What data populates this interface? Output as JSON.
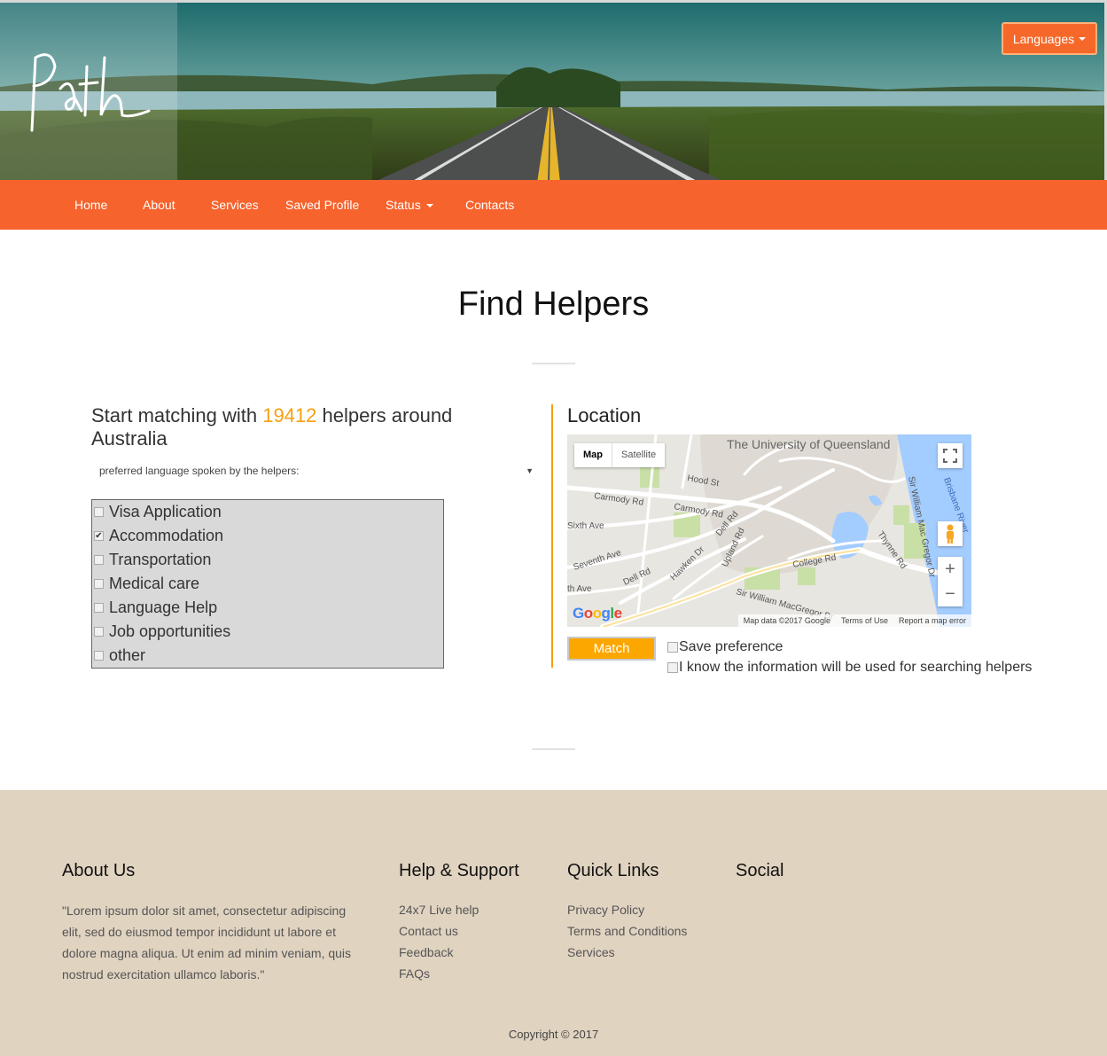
{
  "header": {
    "logo_text": "Path",
    "languages_label": "Languages"
  },
  "nav": {
    "items": [
      {
        "label": "Home"
      },
      {
        "label": "About"
      },
      {
        "label": "Services"
      },
      {
        "label": "Saved Profile"
      },
      {
        "label": "Status"
      },
      {
        "label": "Contacts"
      }
    ]
  },
  "main": {
    "title": "Find Helpers",
    "match_prefix": "Start matching with",
    "helper_count": "19412",
    "match_suffix": "helpers around Australia",
    "language_select_label": "preferred language spoken by the helpers:",
    "services": [
      {
        "label": "Visa Application",
        "checked": false
      },
      {
        "label": "Accommodation",
        "checked": true
      },
      {
        "label": "Transportation",
        "checked": false
      },
      {
        "label": "Medical care",
        "checked": false
      },
      {
        "label": "Language Help",
        "checked": false
      },
      {
        "label": "Job opportunities",
        "checked": false
      },
      {
        "label": "other",
        "checked": false
      }
    ]
  },
  "location": {
    "title": "Location",
    "map_tab_map": "Map",
    "map_tab_satellite": "Satellite",
    "map_attribution": "Map data ©2017 Google",
    "map_terms": "Terms of Use",
    "map_report": "Report a map error",
    "zoom_in": "+",
    "zoom_out": "−",
    "google": "Google",
    "streets": {
      "university": "The University of Queensland",
      "hood": "Hood St",
      "carmody1": "Carmody Rd",
      "carmody2": "Carmody Rd",
      "sixth": "Sixth Ave",
      "seventh": "Seventh Ave",
      "dell1": "Dell Rd",
      "dell2": "Dell Rd",
      "hawken": "Hawken Dr",
      "upland": "Upland Rd",
      "college": "College Rd",
      "macgregor": "Sir William MacGregor Dr",
      "sirwilliam": "Sir William Mac Gregor Dr",
      "thynne": "Thynne Rd",
      "brisbane": "Brisbane River",
      "thave": "th Ave"
    },
    "match_button": "Match",
    "save_preference": "Save preference",
    "consent": "I know the information will be used for searching helpers"
  },
  "footer": {
    "about_title": "About Us",
    "about_text": "\"Lorem ipsum dolor sit amet, consectetur adipiscing elit, sed do eiusmod tempor incididunt ut labore et dolore magna aliqua. Ut enim ad minim veniam, quis nostrud exercitation ullamco laboris.\"",
    "help_title": "Help & Support",
    "help_links": [
      "24x7 Live help",
      "Contact us",
      "Feedback",
      "FAQs"
    ],
    "quick_title": "Quick Links",
    "quick_links": [
      "Privacy Policy",
      "Terms and Conditions",
      "Services"
    ],
    "social_title": "Social",
    "copyright": "Copyright © 2017"
  },
  "colors": {
    "nav": "#f6632d",
    "accent": "#f5a013",
    "match_button": "#fca600",
    "footer": "#e0d3c0"
  }
}
